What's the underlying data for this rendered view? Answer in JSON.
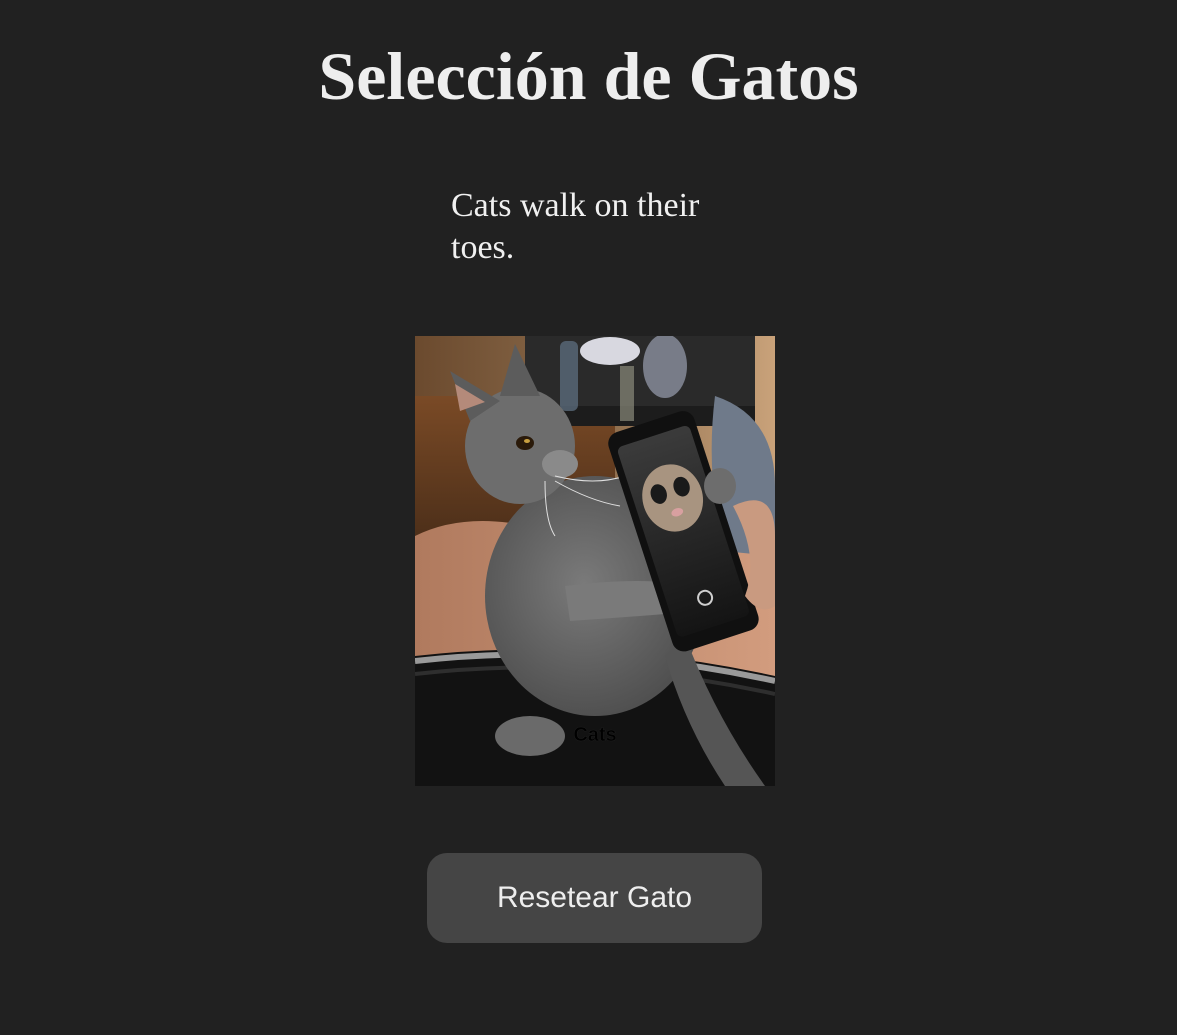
{
  "page": {
    "title": "Selección de Gatos",
    "background_color": "#212121",
    "text_color": "#eeeeee"
  },
  "fact": {
    "text": "Cats walk on their toes."
  },
  "image": {
    "subject": "gray cat holding a smartphone showing a cat photo",
    "caption_overlay": "Cats"
  },
  "reset_button": {
    "label": "Resetear Gato",
    "background_color": "#454545"
  }
}
